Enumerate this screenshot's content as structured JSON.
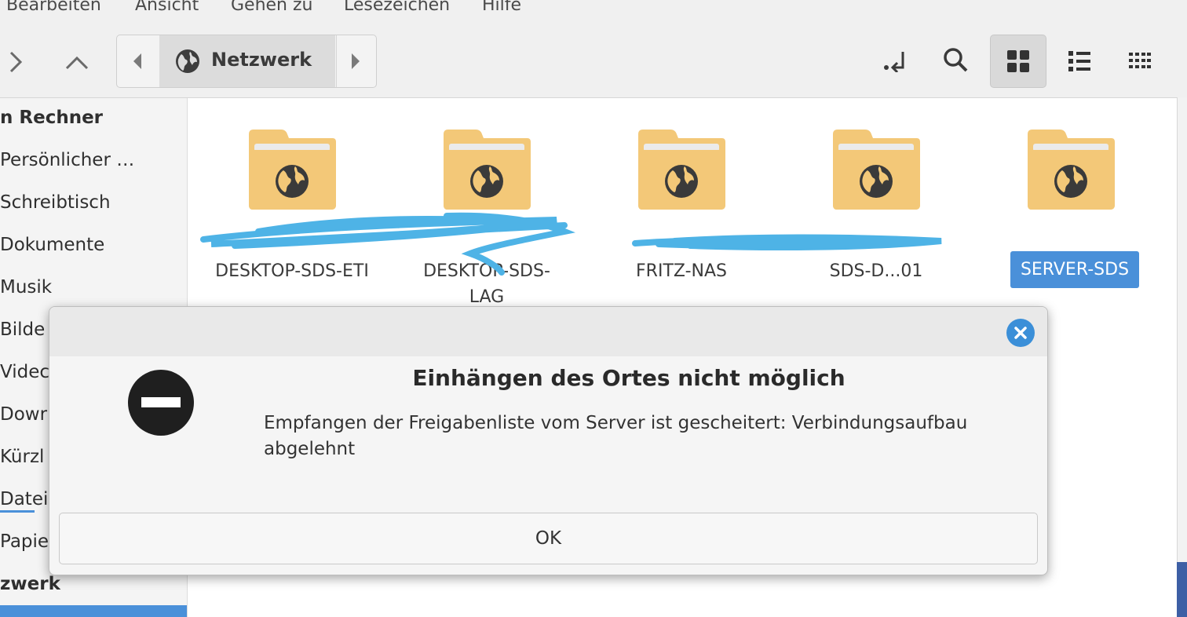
{
  "menubar": {
    "items": [
      "Bearbeiten",
      "Ansicht",
      "Gehen zu",
      "Lesezeichen",
      "Hilfe"
    ]
  },
  "toolbar": {
    "forward_icon": "chevron-right-icon",
    "up_icon": "chevron-up-icon",
    "location": "Netzwerk",
    "location_icon": "globe-icon",
    "toggle_location_icon": "location-entry-icon",
    "search_icon": "search-icon",
    "views": [
      "icon-view",
      "list-view",
      "compact-view"
    ],
    "active_view": "icon-view"
  },
  "sidebar": {
    "section_computer": "n Rechner",
    "items": [
      "Persönlicher …",
      "Schreibtisch",
      "Dokumente",
      "Musik",
      "Bilde",
      "Videc",
      "Dowr",
      "Kürzl",
      "Datei",
      "Papie"
    ],
    "section_network": "zwerk"
  },
  "content": {
    "folders": [
      {
        "label": "DESKTOP-SDS-ETI",
        "icon": "network-folder-icon"
      },
      {
        "label": "DESKTOP-SDS-LAG",
        "icon": "network-folder-icon"
      },
      {
        "label": "FRITZ-NAS",
        "icon": "network-folder-icon"
      },
      {
        "label": "SDS-D...01",
        "icon": "network-folder-icon"
      },
      {
        "label": "SERVER-SDS",
        "icon": "network-folder-icon",
        "selected": true
      }
    ],
    "accent_color": "#4a90d9",
    "folder_color": "#f3c878"
  },
  "dialog": {
    "heading": "Einhängen des Ortes nicht möglich",
    "message": "Empfangen der Freigabenliste vom Server ist gescheitert: Verbindungsaufbau abgelehnt",
    "ok_label": "OK",
    "icon": "error-icon",
    "close_icon": "close-icon",
    "close_color": "#3b8fd8"
  }
}
